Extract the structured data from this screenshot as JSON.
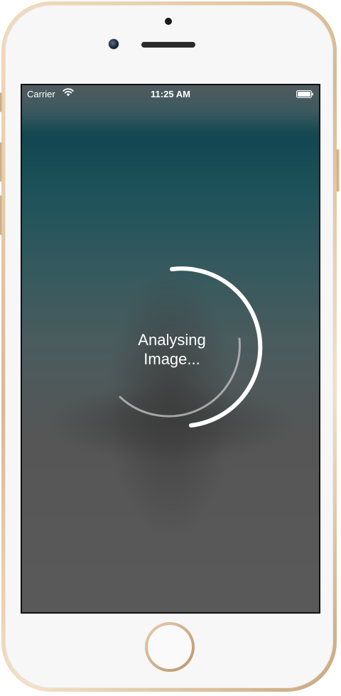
{
  "status_bar": {
    "carrier": "Carrier",
    "time": "11:25 AM",
    "wifi_icon": "wifi-icon",
    "battery_icon": "battery-icon"
  },
  "loading": {
    "line1": "Analysing",
    "line2": "Image..."
  },
  "colors": {
    "frame_gold": "#d8b991",
    "screen_overlay": "#5a5a5a",
    "teal_background": "#124751",
    "spinner_white": "#ffffff"
  }
}
